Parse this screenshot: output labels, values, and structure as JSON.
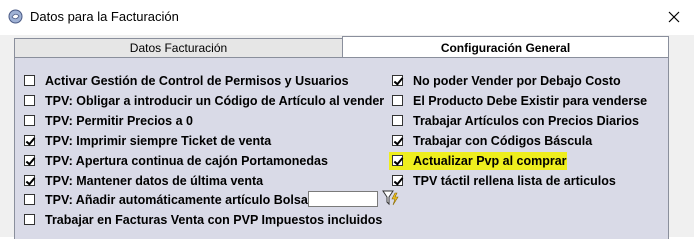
{
  "window": {
    "title": "Datos para la Facturación",
    "close_icon": "close-icon",
    "app_icon": "app-icon"
  },
  "tabs": [
    {
      "label": "Datos Facturación",
      "active": false
    },
    {
      "label": "Configuración General",
      "active": true
    }
  ],
  "left_options": [
    {
      "label": "Activar Gestión de Control de Permisos y Usuarios",
      "checked": false
    },
    {
      "label": "TPV: Obligar a introducir un Código de Artículo al vender",
      "checked": false
    },
    {
      "label": "TPV: Permitir Precios a 0",
      "checked": false
    },
    {
      "label": "TPV: Imprimir siempre Ticket de venta",
      "checked": true
    },
    {
      "label": "TPV: Apertura continua de cajón Portamonedas",
      "checked": true
    },
    {
      "label": "TPV: Mantener datos de última venta",
      "checked": true
    },
    {
      "label": "TPV: Añadir automáticamente artículo Bolsas:",
      "checked": false
    },
    {
      "label": "Trabajar en Facturas Venta con PVP Impuestos incluidos",
      "checked": false
    }
  ],
  "right_options": [
    {
      "label": "No poder Vender por Debajo Costo",
      "checked": true
    },
    {
      "label": "El Producto Debe Existir para venderse",
      "checked": false
    },
    {
      "label": "Trabajar Artículos con Precios Diarios",
      "checked": false
    },
    {
      "label": "Trabajar con Códigos Báscula",
      "checked": true
    },
    {
      "label": "Actualizar Pvp al comprar",
      "checked": true,
      "highlighted": true
    },
    {
      "label": "TPV táctil rellena lista de articulos",
      "checked": true
    }
  ],
  "bolsas_input": {
    "value": ""
  },
  "colors": {
    "panel": "#d9dae7",
    "highlight": "#eeee1e"
  }
}
